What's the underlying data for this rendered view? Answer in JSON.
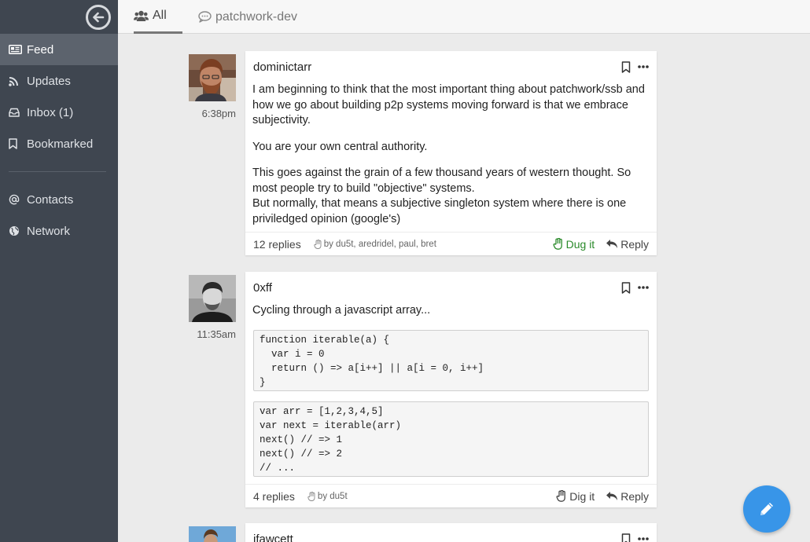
{
  "tabs": [
    {
      "label": "All"
    },
    {
      "label": "patchwork-dev"
    }
  ],
  "sidebar": {
    "items": [
      {
        "label": "Feed"
      },
      {
        "label": "Updates"
      },
      {
        "label": "Inbox (1)"
      },
      {
        "label": "Bookmarked"
      },
      {
        "label": "Contacts"
      },
      {
        "label": "Network"
      }
    ]
  },
  "posts": [
    {
      "author": "dominictarr",
      "time": "6:38pm",
      "paragraphs": [
        "I am beginning to think that the most important thing about patchwork/ssb and how we go about building p2p systems moving forward is that we embrace subjectivity.",
        "You are your own central authority.",
        "This goes against the grain of a few thousand years of western thought. So most people try to build \"objective\" systems.",
        "But normally, that means a subjective singleton system where there is one priviledged opinion (google's)"
      ],
      "replies": "12 replies",
      "dug_by": "by du5t, aredridel, paul, bret",
      "dig_label": "Dug it",
      "reply_label": "Reply"
    },
    {
      "author": "0xff",
      "time": "11:35am",
      "paragraphs": [
        "Cycling through a javascript array..."
      ],
      "code_blocks": [
        "function iterable(a) {\n  var i = 0\n  return () => a[i++] || a[i = 0, i++]\n}",
        "var arr = [1,2,3,4,5]\nvar next = iterable(arr)\nnext() // => 1\nnext() // => 2\n// ..."
      ],
      "replies": "4 replies",
      "dug_by": "by du5t",
      "dig_label": "Dig it",
      "reply_label": "Reply"
    },
    {
      "author": "ifawcett"
    }
  ],
  "colors": {
    "sidebar_bg": "#3f4650",
    "sidebar_active": "#5c636d",
    "fab": "#3895e8",
    "dug": "#2a8a2a"
  },
  "icons": [
    "back-arrow-icon",
    "users-icon",
    "chat-bubble-icon",
    "newspaper-icon",
    "rss-icon",
    "inbox-icon",
    "bookmark-icon",
    "at-icon",
    "globe-icon",
    "more-icon",
    "hand-icon",
    "reply-icon",
    "pencil-icon"
  ]
}
